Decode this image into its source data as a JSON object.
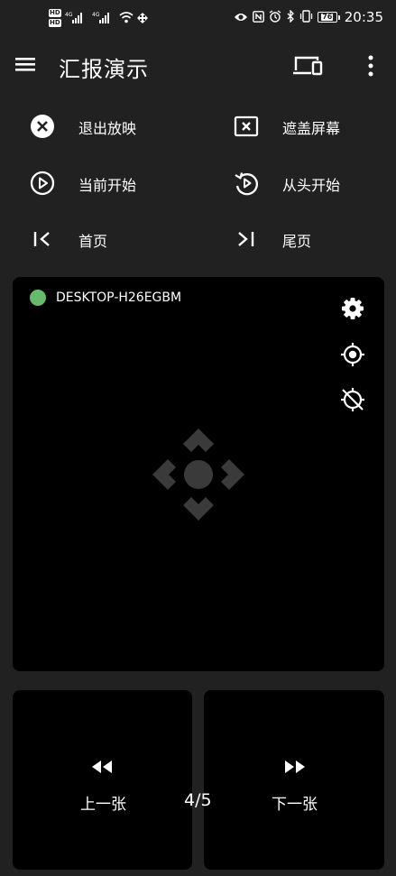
{
  "status_bar": {
    "network_badges": [
      "HD",
      "HD"
    ],
    "signal_labels": [
      "4G",
      "4G"
    ],
    "battery_level": "76",
    "time": "20:35",
    "icons": [
      "hd-icon",
      "signal-icon",
      "wifi-icon",
      "data-icon",
      "eye-icon",
      "nfc-icon",
      "alarm-icon",
      "bluetooth-icon",
      "vibrate-icon",
      "battery-icon"
    ]
  },
  "app_bar": {
    "title": "汇报演示",
    "icons": [
      "menu-icon",
      "devices-icon",
      "more-vert-icon"
    ]
  },
  "actions": {
    "exit_show": "退出放映",
    "cover_screen": "遮盖屏幕",
    "start_current": "当前开始",
    "start_beginning": "从头开始",
    "first_page": "首页",
    "last_page": "尾页"
  },
  "remote": {
    "device_name": "DESKTOP-H26EGBM",
    "connection_color": "#66bb6a",
    "tools": [
      "settings-icon",
      "gps-fixed-icon",
      "gps-off-icon"
    ],
    "dpad_icon": "dpad-icon"
  },
  "navigation": {
    "prev_label": "上一张",
    "next_label": "下一张",
    "page_counter": "4/5"
  }
}
